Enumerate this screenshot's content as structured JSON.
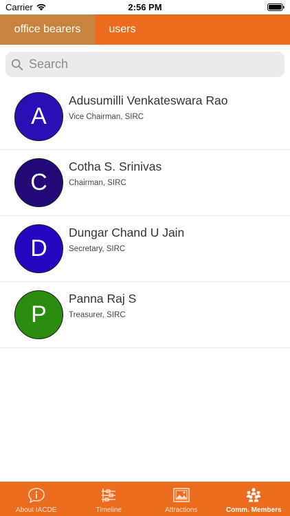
{
  "status_bar": {
    "carrier": "Carrier",
    "time": "2:56 PM"
  },
  "tabs": [
    {
      "label": "office bearers",
      "active": true
    },
    {
      "label": "users",
      "active": false
    }
  ],
  "search": {
    "placeholder": "Search",
    "value": ""
  },
  "members": [
    {
      "initial": "A",
      "name": "Adusumilli Venkateswara Rao",
      "role": "Vice Chairman, SIRC",
      "avatar_color": "#2a0fb5"
    },
    {
      "initial": "C",
      "name": "Cotha S. Srinivas",
      "role": "Chairman, SIRC",
      "avatar_color": "#230a78"
    },
    {
      "initial": "D",
      "name": "Dungar Chand U Jain",
      "role": "Secretary, SIRC",
      "avatar_color": "#2408c0"
    },
    {
      "initial": "P",
      "name": "Panna Raj S",
      "role": "Treasurer, SIRC",
      "avatar_color": "#2a8c0e"
    }
  ],
  "bottom_tabs": [
    {
      "label": "About IACDE",
      "icon": "info-icon",
      "active": false
    },
    {
      "label": "Timeline",
      "icon": "timeline-icon",
      "active": false
    },
    {
      "label": "Attractions",
      "icon": "picture-icon",
      "active": false
    },
    {
      "label": "Comm. Members",
      "icon": "group-icon",
      "active": true
    }
  ],
  "colors": {
    "accent": "#ec6c1f",
    "active_tab": "#c8843e",
    "search_bg": "#ebebed"
  }
}
